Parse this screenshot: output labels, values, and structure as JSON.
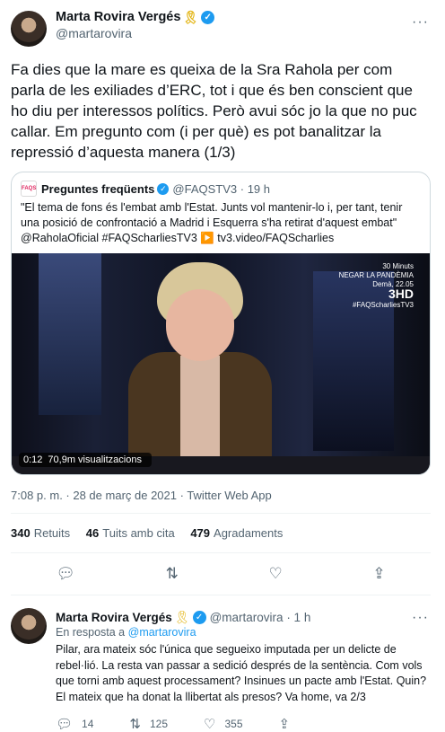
{
  "tweet": {
    "author_name": "Marta Rovira Vergés",
    "author_handle": "@martarovira",
    "text": "Fa dies que la mare es queixa de la Sra Rahola per com parla de les exiliades d’ERC, tot i que és ben conscient que ho diu per interessos polítics. Però avui sóc jo la que no puc callar. Em pregunto com (i per què) es pot banalitzar la repressió d’aquesta manera (1/3)",
    "more_icon": "more-icon",
    "quote": {
      "logo_text": "FAQS",
      "name": "Preguntes freqüents",
      "handle": "@FAQSTV3 · 19 h",
      "text": "\"El tema de fons és l'embat amb l'Estat. Junts vol mantenir-lo i, per tant, tenir una posició de confrontació a Madrid i Esquerra s'ha retirat d'aquest embat\" @RaholaOficial #FAQScharliesTV3 ▶️ tv3.video/FAQScharlies",
      "video": {
        "time": "0:12",
        "views": "70,9m visualitzacions",
        "overlay_line1": "30 Minuts",
        "overlay_line2": "NEGAR LA PANDÈMIA",
        "overlay_line3": "Demà, 22.05",
        "channel": "3HD",
        "hashtag": "#FAQScharliesTV3"
      }
    },
    "timestamp": "7:08 p. m. · 28 de març de 2021 · Twitter Web App",
    "stats": {
      "retweets": "340",
      "retweets_label": "Retuits",
      "quotes": "46",
      "quotes_label": "Tuits amb cita",
      "likes": "479",
      "likes_label": "Agradaments"
    }
  },
  "reply": {
    "author_name": "Marta Rovira Vergés",
    "author_handle": "@martarovira · 1 h",
    "replying_prefix": "En resposta a",
    "replying_to": "@martarovira",
    "text": "Pilar, ara mateix sóc l'única que segueixo imputada per un delicte de rebel·lió. La resta van passar a sedició després de la sentència. Com vols que torni amb aquest processament? Insinues un pacte amb l'Estat. Quin? El mateix que ha donat la llibertat als presos? Va home, va 2/3",
    "reply_count": "14",
    "retweet_count": "125",
    "like_count": "355"
  },
  "colors": {
    "accent": "#1d9bf0",
    "muted": "#536471",
    "ribbon": "#e3b515"
  }
}
